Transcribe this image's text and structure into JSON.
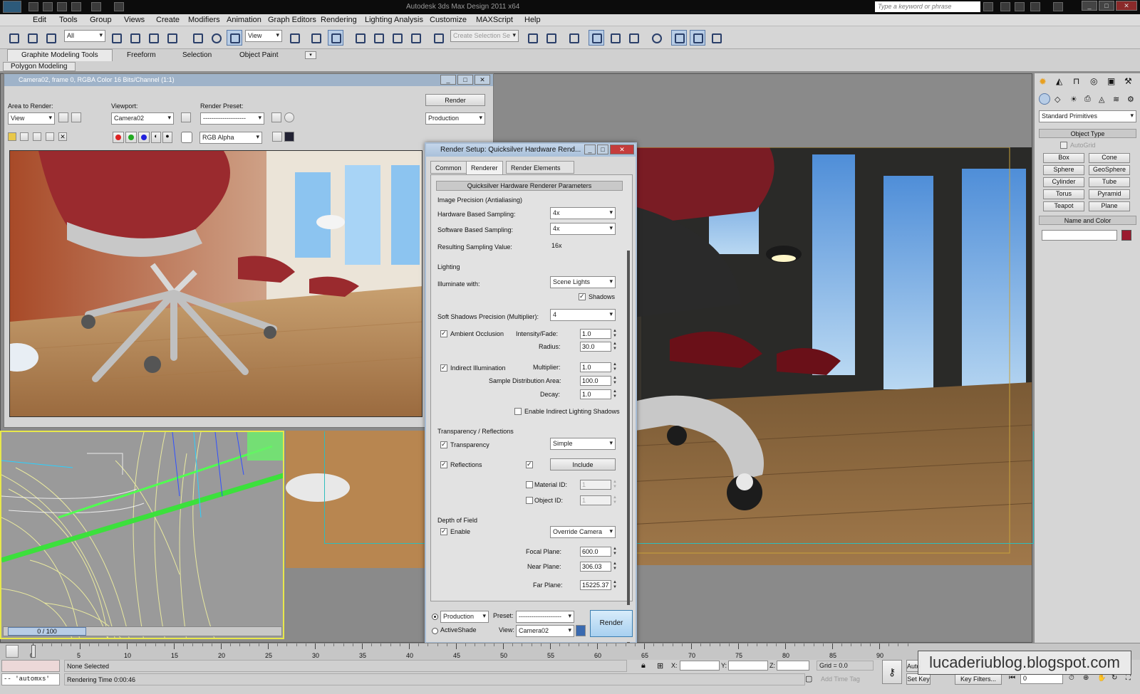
{
  "app": {
    "title": "Autodesk 3ds Max Design 2011 x64",
    "search_placeholder": "Type a keyword or phrase",
    "logo": "3DS"
  },
  "menu": [
    "Edit",
    "Tools",
    "Group",
    "Views",
    "Create",
    "Modifiers",
    "Animation",
    "Graph Editors",
    "Rendering",
    "Lighting Analysis",
    "Customize",
    "MAXScript",
    "Help"
  ],
  "toolbar": {
    "selection_filter": "All",
    "ref_coord": "View",
    "named_selection": "Create Selection Se"
  },
  "ribbon": {
    "tabs": [
      "Graphite Modeling Tools",
      "Freeform",
      "Selection",
      "Object Paint"
    ],
    "panel": "Polygon Modeling"
  },
  "frame_window": {
    "title": "Camera02, frame 0, RGBA Color 16 Bits/Channel (1:1)",
    "area_label": "Area to Render:",
    "area_value": "View",
    "viewport_label": "Viewport:",
    "viewport_value": "Camera02",
    "preset_label": "Render Preset:",
    "preset_value": "--------------------",
    "render_button": "Render",
    "mode_value": "Production",
    "channel_value": "RGB Alpha"
  },
  "render_setup": {
    "title": "Render Setup: Quicksilver Hardware Rend...",
    "tabs": [
      "Common",
      "Renderer",
      "Render Elements"
    ],
    "rollout": "Quicksilver Hardware Renderer Parameters",
    "image_precision": "Image Precision (Antialiasing)",
    "hw_sampling_label": "Hardware Based Sampling:",
    "hw_sampling": "4x",
    "sw_sampling_label": "Software Based Sampling:",
    "sw_sampling": "4x",
    "resulting_label": "Resulting Sampling Value:",
    "resulting": "16x",
    "lighting": "Lighting",
    "illuminate_label": "Illuminate with:",
    "illuminate": "Scene Lights",
    "shadows": "Shadows",
    "soft_shadows_label": "Soft Shadows Precision (Multiplier):",
    "soft_shadows": "4",
    "ao_label": "Ambient Occlusion",
    "intensity_label": "Intensity/Fade:",
    "intensity": "1.0",
    "radius_label": "Radius:",
    "radius": "30.0",
    "indirect_label": "Indirect Illumination",
    "multiplier_label": "Multiplier:",
    "multiplier": "1.0",
    "sample_area_label": "Sample Distribution Area:",
    "sample_area": "100.0",
    "decay_label": "Decay:",
    "decay": "1.0",
    "indirect_shadows": "Enable Indirect Lighting Shadows",
    "trans_refl": "Transparency / Reflections",
    "transparency_label": "Transparency",
    "transparency": "Simple",
    "reflections_label": "Reflections",
    "include_button": "Include",
    "material_id_label": "Material ID:",
    "material_id": "1",
    "object_id_label": "Object ID:",
    "object_id": "1",
    "dof": "Depth of Field",
    "dof_enable": "Enable",
    "dof_mode": "Override Camera",
    "focal_label": "Focal Plane:",
    "focal": "600.0",
    "near_label": "Near Plane:",
    "near": "306.03",
    "far_label": "Far Plane:",
    "far": "15225.37",
    "production": "Production",
    "activeshade": "ActiveShade",
    "preset_label": "Preset:",
    "preset": "--------------------",
    "view_label": "View:",
    "view": "Camera02",
    "render_button": "Render"
  },
  "command_panel": {
    "category": "Standard Primitives",
    "object_type": "Object Type",
    "autogrid": "AutoGrid",
    "primitives": [
      "Box",
      "Cone",
      "Sphere",
      "GeoSphere",
      "Cylinder",
      "Tube",
      "Torus",
      "Pyramid",
      "Teapot",
      "Plane"
    ],
    "name_and_color": "Name and Color",
    "color": "#9b1b2f"
  },
  "timeline": {
    "frame_counter": "0 / 100",
    "ticks": [
      "0",
      "5",
      "10",
      "15",
      "20",
      "25",
      "30",
      "35",
      "40",
      "45",
      "50",
      "55",
      "60",
      "65",
      "70",
      "75",
      "80",
      "85",
      "90"
    ]
  },
  "status": {
    "maxscript": "-- 'automxs'",
    "selection": "None Selected",
    "render_time": "Rendering Time  0:00:46",
    "x_label": "X:",
    "y_label": "Y:",
    "z_label": "Z:",
    "grid": "Grid = 0.0",
    "add_time_tag": "Add Time Tag",
    "auto": "Auto",
    "set_key": "Set Key",
    "key_filters": "Key Filters...",
    "frame": "0"
  },
  "watermark": "lucaderiublog.blogspot.com"
}
